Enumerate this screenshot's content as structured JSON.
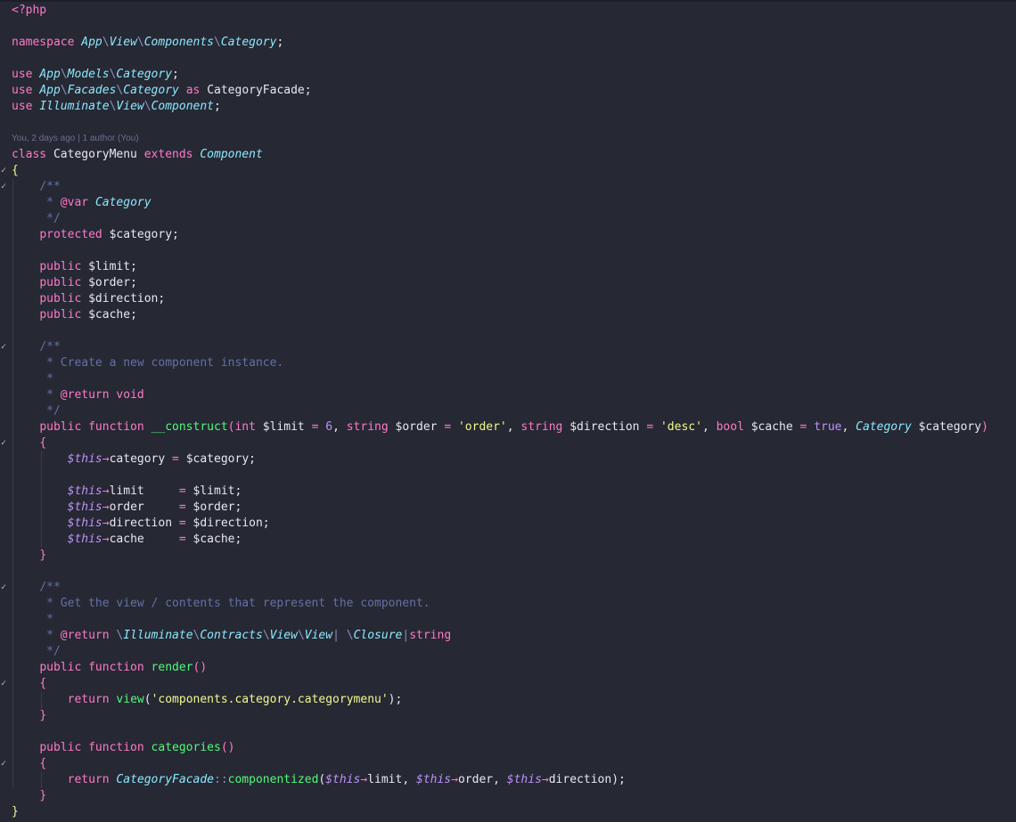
{
  "editor": {
    "language": "php",
    "blame": "You, 2 days ago | 1 author (You)",
    "lines": [
      [
        {
          "t": "<?php",
          "c": "kw"
        }
      ],
      [],
      [
        {
          "t": "namespace ",
          "c": "kw"
        },
        {
          "t": "App",
          "c": "ns"
        },
        {
          "t": "\\",
          "c": "sep"
        },
        {
          "t": "View",
          "c": "ns"
        },
        {
          "t": "\\",
          "c": "sep"
        },
        {
          "t": "Components",
          "c": "ns"
        },
        {
          "t": "\\",
          "c": "sep"
        },
        {
          "t": "Category",
          "c": "ns"
        },
        {
          "t": ";",
          "c": "punc"
        }
      ],
      [],
      [
        {
          "t": "use ",
          "c": "kw"
        },
        {
          "t": "App",
          "c": "ns"
        },
        {
          "t": "\\",
          "c": "sep"
        },
        {
          "t": "Models",
          "c": "ns"
        },
        {
          "t": "\\",
          "c": "sep"
        },
        {
          "t": "Category",
          "c": "ns"
        },
        {
          "t": ";",
          "c": "punc"
        }
      ],
      [
        {
          "t": "use ",
          "c": "kw"
        },
        {
          "t": "App",
          "c": "ns"
        },
        {
          "t": "\\",
          "c": "sep"
        },
        {
          "t": "Facades",
          "c": "ns"
        },
        {
          "t": "\\",
          "c": "sep"
        },
        {
          "t": "Category",
          "c": "ns"
        },
        {
          "t": " as ",
          "c": "kw"
        },
        {
          "t": "CategoryFacade",
          "c": "plain"
        },
        {
          "t": ";",
          "c": "punc"
        }
      ],
      [
        {
          "t": "use ",
          "c": "kw"
        },
        {
          "t": "Illuminate",
          "c": "ns"
        },
        {
          "t": "\\",
          "c": "sep"
        },
        {
          "t": "View",
          "c": "ns"
        },
        {
          "t": "\\",
          "c": "sep"
        },
        {
          "t": "Component",
          "c": "ns"
        },
        {
          "t": ";",
          "c": "punc"
        }
      ],
      [],
      "BLAME",
      [
        {
          "t": "class ",
          "c": "kw"
        },
        {
          "t": "CategoryMenu",
          "c": "plain"
        },
        {
          "t": " extends ",
          "c": "kw"
        },
        {
          "t": "Component",
          "c": "type"
        }
      ],
      [
        {
          "t": "{",
          "c": "brace"
        }
      ],
      [
        {
          "t": "    "
        },
        {
          "t": "/**",
          "c": "com"
        }
      ],
      [
        {
          "t": "     "
        },
        {
          "t": "* ",
          "c": "com"
        },
        {
          "t": "@var ",
          "c": "doc"
        },
        {
          "t": "Category",
          "c": "type"
        }
      ],
      [
        {
          "t": "     "
        },
        {
          "t": "*/",
          "c": "com"
        }
      ],
      [
        {
          "t": "    "
        },
        {
          "t": "protected ",
          "c": "kw"
        },
        {
          "t": "$category;",
          "c": "plain"
        }
      ],
      [],
      [
        {
          "t": "    "
        },
        {
          "t": "public ",
          "c": "kw"
        },
        {
          "t": "$limit;",
          "c": "plain"
        }
      ],
      [
        {
          "t": "    "
        },
        {
          "t": "public ",
          "c": "kw"
        },
        {
          "t": "$order;",
          "c": "plain"
        }
      ],
      [
        {
          "t": "    "
        },
        {
          "t": "public ",
          "c": "kw"
        },
        {
          "t": "$direction;",
          "c": "plain"
        }
      ],
      [
        {
          "t": "    "
        },
        {
          "t": "public ",
          "c": "kw"
        },
        {
          "t": "$cache;",
          "c": "plain"
        }
      ],
      [],
      [
        {
          "t": "    "
        },
        {
          "t": "/**",
          "c": "com"
        }
      ],
      [
        {
          "t": "     "
        },
        {
          "t": "* Create a new component instance.",
          "c": "com"
        }
      ],
      [
        {
          "t": "     "
        },
        {
          "t": "*",
          "c": "com"
        }
      ],
      [
        {
          "t": "     "
        },
        {
          "t": "* ",
          "c": "com"
        },
        {
          "t": "@return ",
          "c": "doc"
        },
        {
          "t": "void",
          "c": "doc"
        }
      ],
      [
        {
          "t": "     "
        },
        {
          "t": "*/",
          "c": "com"
        }
      ],
      [
        {
          "t": "    "
        },
        {
          "t": "public function ",
          "c": "kw"
        },
        {
          "t": "__construct",
          "c": "fn"
        },
        {
          "t": "(",
          "c": "paren"
        },
        {
          "t": "int ",
          "c": "ptype"
        },
        {
          "t": "$limit ",
          "c": "plain"
        },
        {
          "t": "= ",
          "c": "kw"
        },
        {
          "t": "6",
          "c": "num"
        },
        {
          "t": ", ",
          "c": "punc"
        },
        {
          "t": "string ",
          "c": "ptype"
        },
        {
          "t": "$order ",
          "c": "plain"
        },
        {
          "t": "= ",
          "c": "kw"
        },
        {
          "t": "'order'",
          "c": "str"
        },
        {
          "t": ", ",
          "c": "punc"
        },
        {
          "t": "string ",
          "c": "ptype"
        },
        {
          "t": "$direction ",
          "c": "plain"
        },
        {
          "t": "= ",
          "c": "kw"
        },
        {
          "t": "'desc'",
          "c": "str"
        },
        {
          "t": ", ",
          "c": "punc"
        },
        {
          "t": "bool ",
          "c": "ptype"
        },
        {
          "t": "$cache ",
          "c": "plain"
        },
        {
          "t": "= ",
          "c": "kw"
        },
        {
          "t": "true",
          "c": "bool"
        },
        {
          "t": ", ",
          "c": "punc"
        },
        {
          "t": "Category",
          "c": "type"
        },
        {
          "t": " $category",
          "c": "plain"
        },
        {
          "t": ")",
          "c": "paren"
        }
      ],
      [
        {
          "t": "    "
        },
        {
          "t": "{",
          "c": "brace2"
        }
      ],
      [
        {
          "t": "        "
        },
        {
          "t": "$this",
          "c": "this"
        },
        {
          "t": "→",
          "c": "arrow"
        },
        {
          "t": "category ",
          "c": "plain"
        },
        {
          "t": "= ",
          "c": "kw"
        },
        {
          "t": "$category;",
          "c": "plain"
        }
      ],
      [],
      [
        {
          "t": "        "
        },
        {
          "t": "$this",
          "c": "this"
        },
        {
          "t": "→",
          "c": "arrow"
        },
        {
          "t": "limit     ",
          "c": "plain"
        },
        {
          "t": "= ",
          "c": "kw"
        },
        {
          "t": "$limit;",
          "c": "plain"
        }
      ],
      [
        {
          "t": "        "
        },
        {
          "t": "$this",
          "c": "this"
        },
        {
          "t": "→",
          "c": "arrow"
        },
        {
          "t": "order     ",
          "c": "plain"
        },
        {
          "t": "= ",
          "c": "kw"
        },
        {
          "t": "$order;",
          "c": "plain"
        }
      ],
      [
        {
          "t": "        "
        },
        {
          "t": "$this",
          "c": "this"
        },
        {
          "t": "→",
          "c": "arrow"
        },
        {
          "t": "direction ",
          "c": "plain"
        },
        {
          "t": "= ",
          "c": "kw"
        },
        {
          "t": "$direction;",
          "c": "plain"
        }
      ],
      [
        {
          "t": "        "
        },
        {
          "t": "$this",
          "c": "this"
        },
        {
          "t": "→",
          "c": "arrow"
        },
        {
          "t": "cache     ",
          "c": "plain"
        },
        {
          "t": "= ",
          "c": "kw"
        },
        {
          "t": "$cache;",
          "c": "plain"
        }
      ],
      [
        {
          "t": "    "
        },
        {
          "t": "}",
          "c": "brace2"
        }
      ],
      [],
      [
        {
          "t": "    "
        },
        {
          "t": "/**",
          "c": "com"
        }
      ],
      [
        {
          "t": "     "
        },
        {
          "t": "* Get the view / contents that represent the component.",
          "c": "com"
        }
      ],
      [
        {
          "t": "     "
        },
        {
          "t": "*",
          "c": "com"
        }
      ],
      [
        {
          "t": "     "
        },
        {
          "t": "* ",
          "c": "com"
        },
        {
          "t": "@return ",
          "c": "doc"
        },
        {
          "t": "\\",
          "c": "sep"
        },
        {
          "t": "Illuminate",
          "c": "ns"
        },
        {
          "t": "\\",
          "c": "sep"
        },
        {
          "t": "Contracts",
          "c": "ns"
        },
        {
          "t": "\\",
          "c": "sep"
        },
        {
          "t": "View",
          "c": "ns"
        },
        {
          "t": "\\",
          "c": "sep"
        },
        {
          "t": "View",
          "c": "ns"
        },
        {
          "t": "| ",
          "c": "sep"
        },
        {
          "t": "\\",
          "c": "sep"
        },
        {
          "t": "Closure",
          "c": "ns"
        },
        {
          "t": "|",
          "c": "sep"
        },
        {
          "t": "string",
          "c": "doc"
        }
      ],
      [
        {
          "t": "     "
        },
        {
          "t": "*/",
          "c": "com"
        }
      ],
      [
        {
          "t": "    "
        },
        {
          "t": "public function ",
          "c": "kw"
        },
        {
          "t": "render",
          "c": "fn"
        },
        {
          "t": "()",
          "c": "paren"
        }
      ],
      [
        {
          "t": "    "
        },
        {
          "t": "{",
          "c": "brace2"
        }
      ],
      [
        {
          "t": "        "
        },
        {
          "t": "return ",
          "c": "kw"
        },
        {
          "t": "view",
          "c": "fn"
        },
        {
          "t": "(",
          "c": "punc"
        },
        {
          "t": "'components.category.categorymenu'",
          "c": "str"
        },
        {
          "t": ");",
          "c": "punc"
        }
      ],
      [
        {
          "t": "    "
        },
        {
          "t": "}",
          "c": "brace2"
        }
      ],
      [],
      [
        {
          "t": "    "
        },
        {
          "t": "public function ",
          "c": "kw"
        },
        {
          "t": "categories",
          "c": "fn"
        },
        {
          "t": "()",
          "c": "paren"
        }
      ],
      [
        {
          "t": "    "
        },
        {
          "t": "{",
          "c": "brace2"
        }
      ],
      [
        {
          "t": "        "
        },
        {
          "t": "return ",
          "c": "kw"
        },
        {
          "t": "CategoryFacade",
          "c": "type"
        },
        {
          "t": "::",
          "c": "sep"
        },
        {
          "t": "componentized",
          "c": "fn"
        },
        {
          "t": "(",
          "c": "punc"
        },
        {
          "t": "$this",
          "c": "this"
        },
        {
          "t": "→",
          "c": "arrow"
        },
        {
          "t": "limit, ",
          "c": "plain"
        },
        {
          "t": "$this",
          "c": "this"
        },
        {
          "t": "→",
          "c": "arrow"
        },
        {
          "t": "order, ",
          "c": "plain"
        },
        {
          "t": "$this",
          "c": "this"
        },
        {
          "t": "→",
          "c": "arrow"
        },
        {
          "t": "direction",
          "c": "plain"
        },
        {
          "t": ");",
          "c": "punc"
        }
      ],
      [
        {
          "t": "    "
        },
        {
          "t": "}",
          "c": "brace2"
        }
      ],
      [
        {
          "t": "}",
          "c": "brace"
        }
      ]
    ]
  }
}
